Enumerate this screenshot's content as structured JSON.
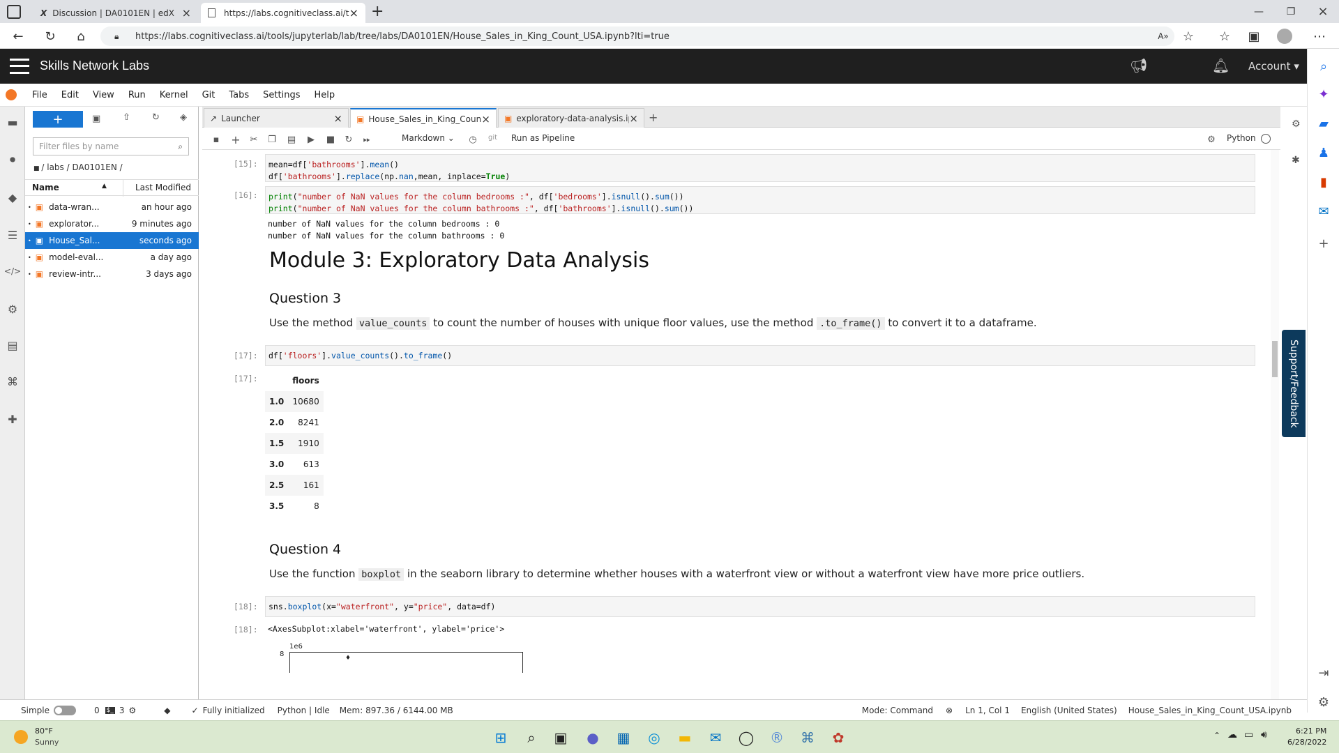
{
  "browser": {
    "tabs": [
      {
        "title": "Discussion | DA0101EN | edX",
        "icon": "edx-icon"
      },
      {
        "title": "https://labs.cognitiveclass.ai/tool",
        "icon": "page-icon"
      }
    ],
    "url": "https://labs.cognitiveclass.ai/tools/jupyterlab/lab/tree/labs/DA0101EN/House_Sales_in_King_Count_USA.ipynb?lti=true"
  },
  "header": {
    "title": "Skills Network Labs",
    "account": "Account"
  },
  "menu": [
    "File",
    "Edit",
    "View",
    "Run",
    "Kernel",
    "Git",
    "Tabs",
    "Settings",
    "Help"
  ],
  "filebrowser": {
    "new_label": "+",
    "filter_placeholder": "Filter files by name",
    "breadcrumb": "/ labs / DA0101EN /",
    "col_name": "Name",
    "col_modified": "Last Modified",
    "files": [
      {
        "name": "data-wran...",
        "modified": "an hour ago",
        "selected": false
      },
      {
        "name": "explorator...",
        "modified": "9 minutes ago",
        "selected": false
      },
      {
        "name": "House_Sal...",
        "modified": "seconds ago",
        "selected": true
      },
      {
        "name": "model-eval...",
        "modified": "a day ago",
        "selected": false
      },
      {
        "name": "review-intr...",
        "modified": "3 days ago",
        "selected": false
      }
    ]
  },
  "doc_tabs": [
    {
      "title": "Launcher",
      "active": false
    },
    {
      "title": "House_Sales_in_King_Coun",
      "active": true
    },
    {
      "title": "exploratory-data-analysis.ip",
      "active": false
    }
  ],
  "toolbar": {
    "cell_type": "Markdown",
    "git": "git",
    "pipeline": "Run as Pipeline",
    "kernel": "Python"
  },
  "cells": {
    "p15": "[15]:",
    "p16": "[16]:",
    "p17": "[17]:",
    "p17out": "[17]:",
    "p18": "[18]:",
    "p18out": "[18]:",
    "out16_line1": "number of NaN values for the column bedrooms : 0",
    "out16_line2": "number of NaN values for the column bathrooms : 0",
    "h_module": "Module 3: Exploratory Data Analysis",
    "h_q3": "Question 3",
    "q3_text_a": "Use the method",
    "q3_code_a": "value_counts",
    "q3_text_b": "to count the number of houses with unique floor values, use the method",
    "q3_code_b": ".to_frame()",
    "q3_text_c": "to convert it to a dataframe.",
    "h_q4": "Question 4",
    "q4_text_a": "Use the function",
    "q4_code_a": "boxplot",
    "q4_text_b": "in the seaborn library to determine whether houses with a waterfront view or without a waterfront view have more price outliers.",
    "out18": "<AxesSubplot:xlabel='waterfront', ylabel='price'>",
    "plot_exp": "1e6",
    "plot_tick": "8"
  },
  "floors_table": {
    "column": "floors",
    "rows": [
      {
        "index": "1.0",
        "value": "10680"
      },
      {
        "index": "2.0",
        "value": "8241"
      },
      {
        "index": "1.5",
        "value": "1910"
      },
      {
        "index": "3.0",
        "value": "613"
      },
      {
        "index": "2.5",
        "value": "161"
      },
      {
        "index": "3.5",
        "value": "8"
      }
    ]
  },
  "statusbar": {
    "mode": "Simple",
    "count_a": "0",
    "count_b": "3",
    "init": "Fully initialized",
    "kernel": "Python | Idle",
    "mem": "Mem: 897.36 / 6144.00 MB",
    "cmd_mode": "Mode: Command",
    "position": "Ln 1, Col 1",
    "lang": "English (United States)",
    "filename": "House_Sales_in_King_Count_USA.ipynb"
  },
  "support": "Support/Feedback",
  "taskbar": {
    "temp": "80°F",
    "weather": "Sunny",
    "time": "6:21 PM",
    "date": "6/28/2022"
  }
}
